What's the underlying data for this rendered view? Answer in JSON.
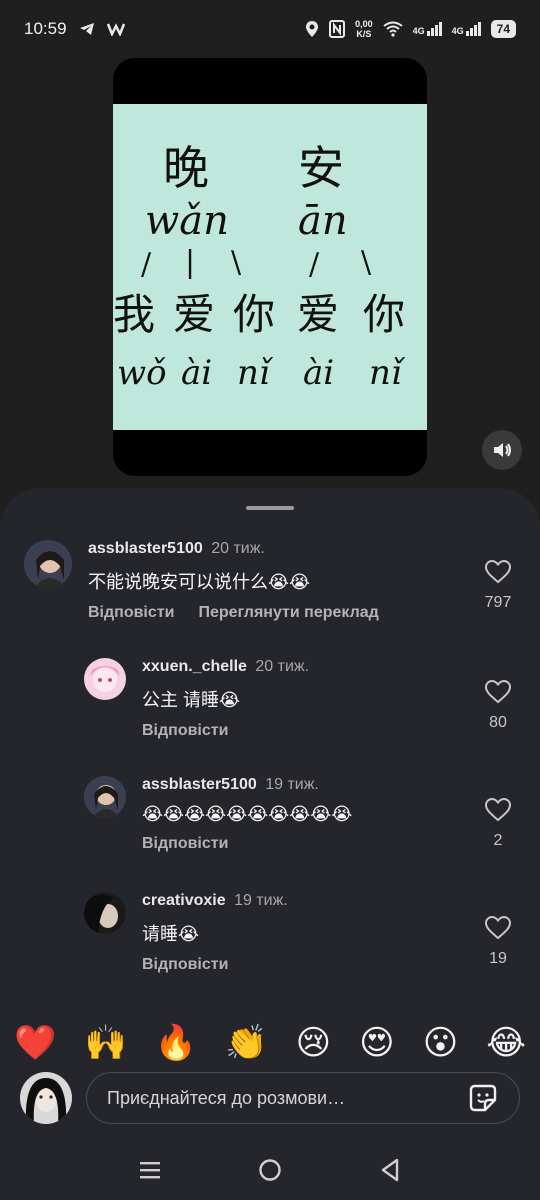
{
  "status_bar": {
    "time": "10:59",
    "net_speed_value": "0,00",
    "net_speed_unit": "K/S",
    "signal_1": "4G",
    "signal_2": "4G",
    "battery": "74"
  },
  "video": {
    "handwriting": {
      "row1": [
        "晚",
        "安"
      ],
      "row2": [
        "wǎn",
        "ān"
      ],
      "row3": [
        "/",
        "|",
        "\\",
        "/",
        "\\"
      ],
      "row4": [
        "我",
        "爱",
        "你",
        "爱",
        "你"
      ],
      "row5": [
        "wǒ",
        "ài",
        "nǐ",
        "ài",
        "nǐ"
      ]
    },
    "sound_icon": "speaker-icon"
  },
  "comments": [
    {
      "user": "assblaster5100",
      "time": "20 тиж.",
      "text": "不能说晚安可以说什么😭😭",
      "reply": "Відповісти",
      "translate": "Переглянути переклад",
      "likes": "797"
    },
    {
      "user": "xxuen._chelle",
      "time": "20 тиж.",
      "text": "公主 请睡😭",
      "reply": "Відповісти",
      "likes": "80"
    },
    {
      "user": "assblaster5100",
      "time": "19 тиж.",
      "text": "😭😭😭😭😭😭😭😭😭😭",
      "reply": "Відповісти",
      "likes": "2"
    },
    {
      "user": "creativoxie",
      "time": "19 тиж.",
      "text": "请睡😭",
      "reply": "Відповісти",
      "likes": "19"
    }
  ],
  "emoji_bar": [
    "❤️",
    "🙌",
    "🔥",
    "👏",
    "😢",
    "😍",
    "😮",
    "😂"
  ],
  "input": {
    "placeholder": "Приєднайтеся до розмови…",
    "sticker_icon": "sticker-icon"
  },
  "colors": {
    "background": "#1f1f1f",
    "sheet": "#25262b",
    "note": "#bfe7dc"
  }
}
